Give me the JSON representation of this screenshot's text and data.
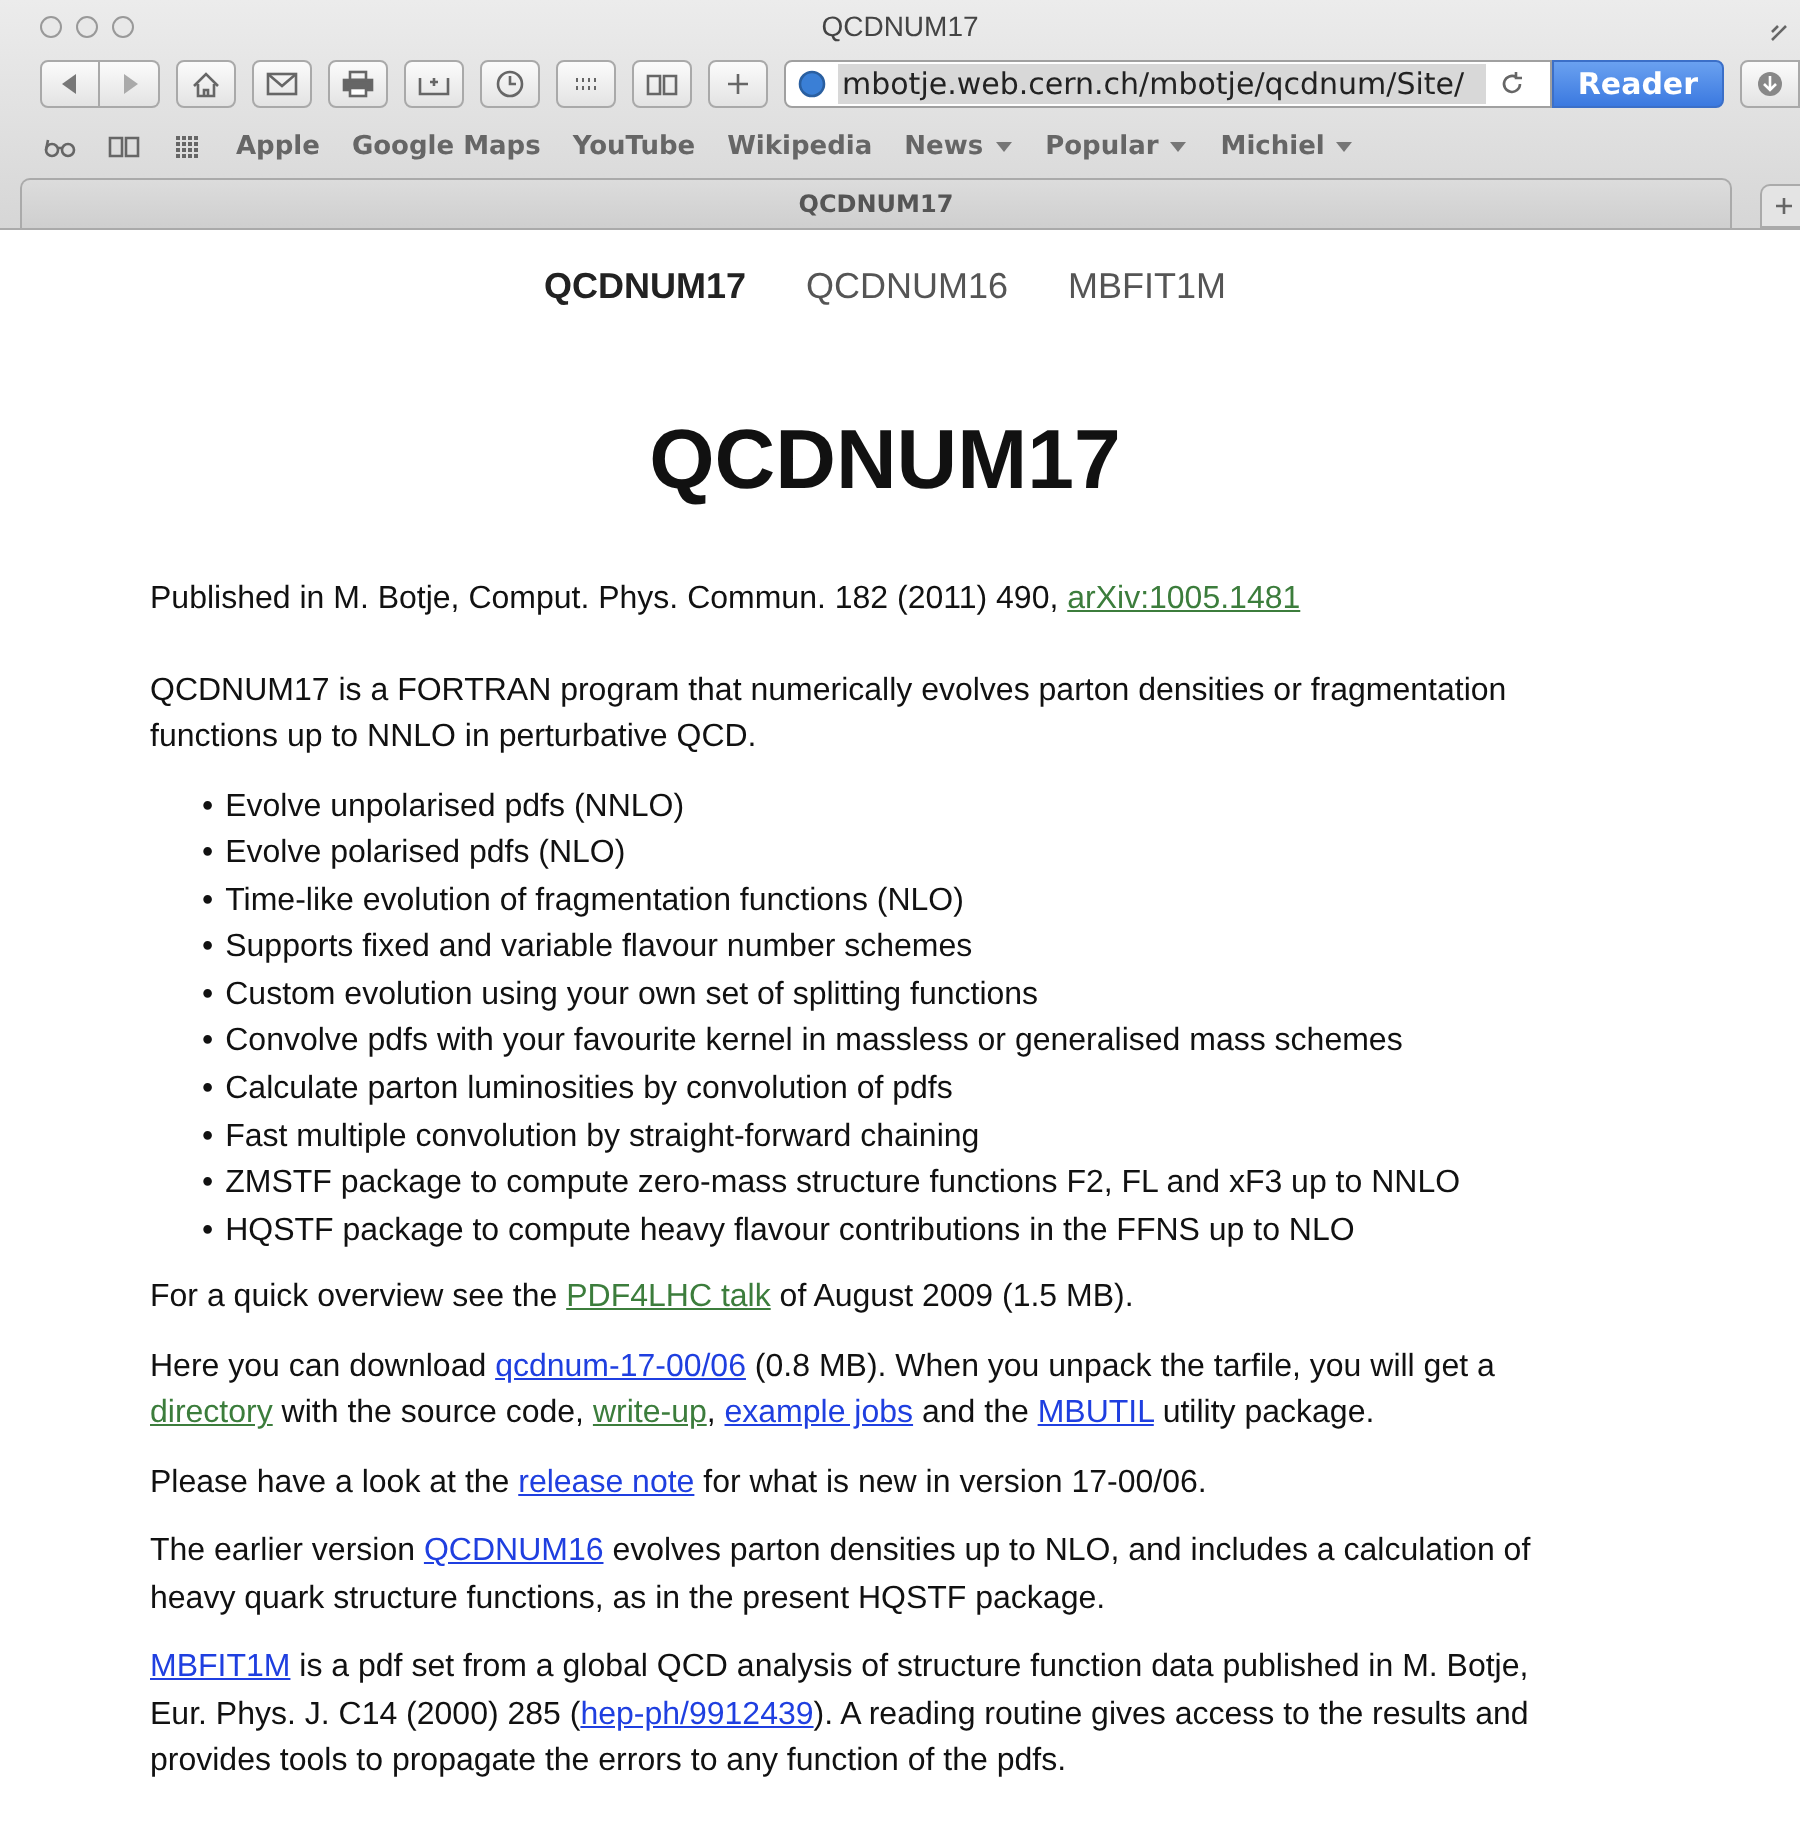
{
  "window": {
    "title": "QCDNUM17"
  },
  "toolbar": {
    "address": "mbotje.web.cern.ch/mbotje/qcdnum/Site/",
    "reader_button": "Reader"
  },
  "bookmarks": [
    {
      "label": "Apple",
      "has_menu": false
    },
    {
      "label": "Google Maps",
      "has_menu": false
    },
    {
      "label": "YouTube",
      "has_menu": false
    },
    {
      "label": "Wikipedia",
      "has_menu": false
    },
    {
      "label": "News",
      "has_menu": true
    },
    {
      "label": "Popular",
      "has_menu": true
    },
    {
      "label": "Michiel",
      "has_menu": true
    }
  ],
  "tabs": [
    {
      "label": "QCDNUM17",
      "selected": true
    }
  ],
  "site_nav": [
    {
      "label": "QCDNUM17",
      "selected": true
    },
    {
      "label": "QCDNUM16",
      "selected": false
    },
    {
      "label": "MBFIT1M",
      "selected": false
    }
  ],
  "heading": "QCDNUM17",
  "citation": [
    {
      "kind": "text",
      "text": "Published in M. Botje, Comput. Phys. Commun. 182 (2011) 490,  "
    },
    {
      "kind": "link",
      "text": "arXiv:1005.1481",
      "visited": true
    }
  ],
  "intro": [
    {
      "kind": "text",
      "text": "QCDNUM17 is a FORTRAN program that numerically evolves parton densities or fragmentation functions up to NNLO in perturbative QCD."
    }
  ],
  "bullet": "•",
  "features": [
    "Evolve unpolarised pdfs (NNLO)",
    "Evolve polarised pdfs (NLO)",
    "Time-like evolution of fragmentation functions (NLO)",
    "Supports fixed and variable flavour number schemes",
    "Custom evolution using your own set of splitting functions",
    "Convolve pdfs with your favourite kernel in massless or generalised mass schemes",
    "Calculate parton luminosities by convolution of pdfs",
    "Fast multiple convolution by straight-forward chaining",
    "ZMSTF package to compute zero-mass structure functions F2, FL and xF3 up to NNLO",
    "HQSTF package to compute heavy flavour contributions in the FFNS up to NLO"
  ],
  "paragraphs": [
    [
      {
        "kind": "text",
        "text": "For a quick overview see the "
      },
      {
        "kind": "link",
        "text": "PDF4LHC talk",
        "visited": true
      },
      {
        "kind": "text",
        "text": " of August 2009 (1.5 MB)."
      }
    ],
    [
      {
        "kind": "text",
        "text": "Here you can download  "
      },
      {
        "kind": "link",
        "text": "qcdnum-17-00/06",
        "visited": false
      },
      {
        "kind": "text",
        "text": " (0.8 MB). When you unpack the tarfile, you will get a "
      },
      {
        "kind": "link",
        "text": "directory",
        "visited": true
      },
      {
        "kind": "text",
        "text": " with the source code, "
      },
      {
        "kind": "link",
        "text": "write-up",
        "visited": true
      },
      {
        "kind": "text",
        "text": ", "
      },
      {
        "kind": "link",
        "text": "example jobs",
        "visited": false
      },
      {
        "kind": "text",
        "text": " and the "
      },
      {
        "kind": "link",
        "text": "MBUTIL",
        "visited": false
      },
      {
        "kind": "text",
        "text": " utility package."
      }
    ],
    [
      {
        "kind": "text",
        "text": "Please have a look at the "
      },
      {
        "kind": "link",
        "text": "release note",
        "visited": false
      },
      {
        "kind": "text",
        "text": " for what is new in version 17-00/06."
      }
    ],
    [
      {
        "kind": "text",
        "text": "The earlier version "
      },
      {
        "kind": "link",
        "text": "QCDNUM16",
        "visited": false
      },
      {
        "kind": "text",
        "text": " evolves parton densities up to NLO, and includes a calculation of heavy quark structure functions, as in the present HQSTF package."
      }
    ],
    [
      {
        "kind": "link",
        "text": "MBFIT1M",
        "visited": false
      },
      {
        "kind": "text",
        "text": " is a pdf set from a  global QCD analysis of structure function data published in M. Botje, Eur. Phys. J. C14 (2000) 285 ("
      },
      {
        "kind": "link",
        "text": "hep-ph/9912439",
        "visited": false
      },
      {
        "kind": "text",
        "text": "). A reading routine gives access to the results and provides tools to propagate the errors to any function of the pdfs."
      }
    ]
  ]
}
